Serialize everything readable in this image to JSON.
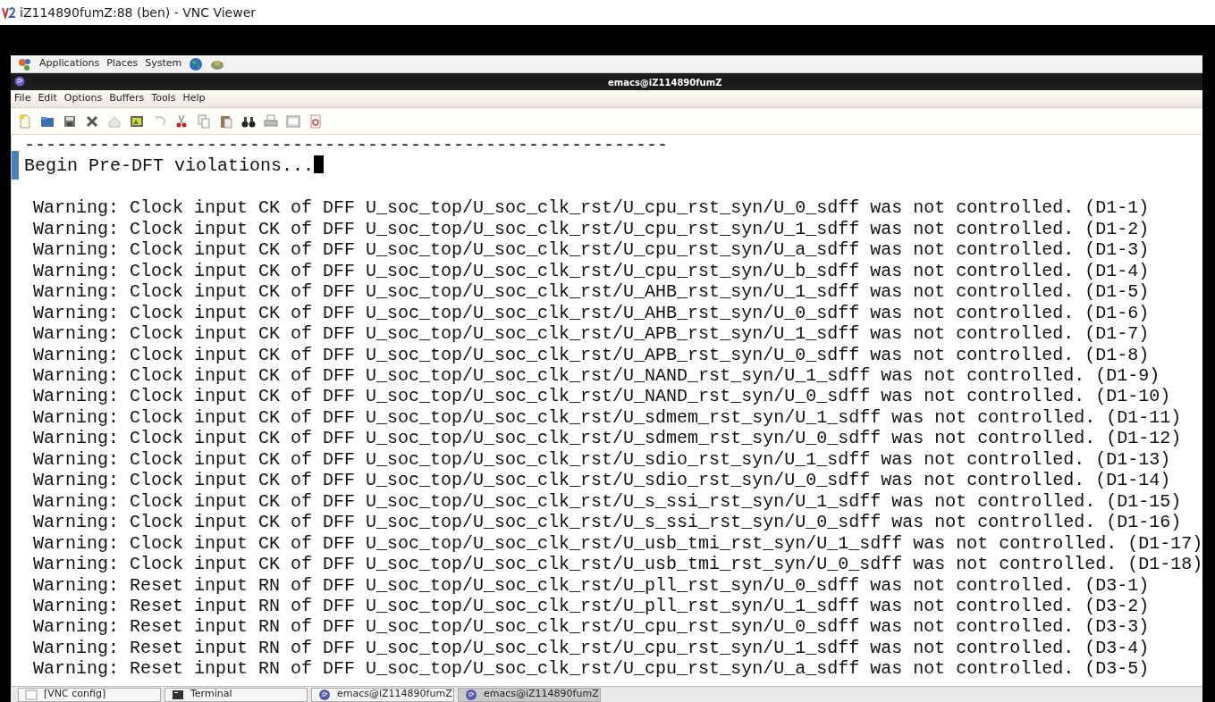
{
  "window": {
    "title": "iZ114890fumZ:88 (ben) - VNC Viewer"
  },
  "panel": {
    "menus": [
      "Applications",
      "Places",
      "System"
    ]
  },
  "emacs": {
    "title": "emacs@iZ114890fumZ",
    "menu_bar": [
      "File",
      "Edit",
      "Options",
      "Buffers",
      "Tools",
      "Help"
    ],
    "buffer": {
      "rule": "------------------------------------------------------------",
      "heading": "Begin Pre-DFT violations...",
      "lines": [
        "Warning: Clock input CK of DFF U_soc_top/U_soc_clk_rst/U_cpu_rst_syn/U_0_sdff was not controlled. (D1-1)",
        "Warning: Clock input CK of DFF U_soc_top/U_soc_clk_rst/U_cpu_rst_syn/U_1_sdff was not controlled. (D1-2)",
        "Warning: Clock input CK of DFF U_soc_top/U_soc_clk_rst/U_cpu_rst_syn/U_a_sdff was not controlled. (D1-3)",
        "Warning: Clock input CK of DFF U_soc_top/U_soc_clk_rst/U_cpu_rst_syn/U_b_sdff was not controlled. (D1-4)",
        "Warning: Clock input CK of DFF U_soc_top/U_soc_clk_rst/U_AHB_rst_syn/U_1_sdff was not controlled. (D1-5)",
        "Warning: Clock input CK of DFF U_soc_top/U_soc_clk_rst/U_AHB_rst_syn/U_0_sdff was not controlled. (D1-6)",
        "Warning: Clock input CK of DFF U_soc_top/U_soc_clk_rst/U_APB_rst_syn/U_1_sdff was not controlled. (D1-7)",
        "Warning: Clock input CK of DFF U_soc_top/U_soc_clk_rst/U_APB_rst_syn/U_0_sdff was not controlled. (D1-8)",
        "Warning: Clock input CK of DFF U_soc_top/U_soc_clk_rst/U_NAND_rst_syn/U_1_sdff was not controlled. (D1-9)",
        "Warning: Clock input CK of DFF U_soc_top/U_soc_clk_rst/U_NAND_rst_syn/U_0_sdff was not controlled. (D1-10)",
        "Warning: Clock input CK of DFF U_soc_top/U_soc_clk_rst/U_sdmem_rst_syn/U_1_sdff was not controlled. (D1-11)",
        "Warning: Clock input CK of DFF U_soc_top/U_soc_clk_rst/U_sdmem_rst_syn/U_0_sdff was not controlled. (D1-12)",
        "Warning: Clock input CK of DFF U_soc_top/U_soc_clk_rst/U_sdio_rst_syn/U_1_sdff was not controlled. (D1-13)",
        "Warning: Clock input CK of DFF U_soc_top/U_soc_clk_rst/U_sdio_rst_syn/U_0_sdff was not controlled. (D1-14)",
        "Warning: Clock input CK of DFF U_soc_top/U_soc_clk_rst/U_s_ssi_rst_syn/U_1_sdff was not controlled. (D1-15)",
        "Warning: Clock input CK of DFF U_soc_top/U_soc_clk_rst/U_s_ssi_rst_syn/U_0_sdff was not controlled. (D1-16)",
        "Warning: Clock input CK of DFF U_soc_top/U_soc_clk_rst/U_usb_tmi_rst_syn/U_1_sdff was not controlled. (D1-17)",
        "Warning: Clock input CK of DFF U_soc_top/U_soc_clk_rst/U_usb_tmi_rst_syn/U_0_sdff was not controlled. (D1-18)",
        "Warning: Reset input RN of DFF U_soc_top/U_soc_clk_rst/U_pll_rst_syn/U_0_sdff was not controlled. (D3-1)",
        "Warning: Reset input RN of DFF U_soc_top/U_soc_clk_rst/U_pll_rst_syn/U_1_sdff was not controlled. (D3-2)",
        "Warning: Reset input RN of DFF U_soc_top/U_soc_clk_rst/U_cpu_rst_syn/U_0_sdff was not controlled. (D3-3)",
        "Warning: Reset input RN of DFF U_soc_top/U_soc_clk_rst/U_cpu_rst_syn/U_1_sdff was not controlled. (D3-4)",
        "Warning: Reset input RN of DFF U_soc_top/U_soc_clk_rst/U_cpu_rst_syn/U_a_sdff was not controlled. (D3-5)"
      ]
    }
  },
  "taskbar": {
    "items": [
      {
        "label": "[VNC config]",
        "selected": false
      },
      {
        "label": "Terminal",
        "selected": false
      },
      {
        "label": "emacs@iZ114890fumZ",
        "selected": false
      },
      {
        "label": "emacs@iZ114890fumZ",
        "selected": true
      }
    ]
  }
}
